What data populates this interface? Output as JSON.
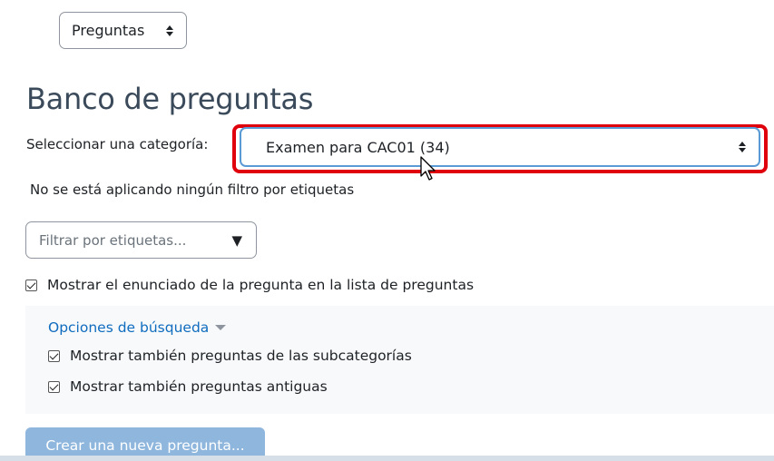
{
  "nav": {
    "select_value": "Preguntas"
  },
  "page": {
    "title": "Banco de preguntas"
  },
  "category": {
    "label": "Seleccionar una categoría:",
    "selected": "Examen para CAC01 (34)"
  },
  "filter": {
    "status": "No se está aplicando ningún filtro por etiquetas",
    "placeholder": "Filtrar por etiquetas..."
  },
  "show_question_text": {
    "label": "Mostrar el enunciado de la pregunta en la lista de preguntas",
    "checked": true
  },
  "search_options": {
    "title": "Opciones de búsqueda",
    "subcategories": {
      "label": "Mostrar también preguntas de las subcategorías",
      "checked": true
    },
    "old_questions": {
      "label": "Mostrar también preguntas antiguas",
      "checked": true
    }
  },
  "actions": {
    "create_label": "Crear una nueva pregunta..."
  },
  "colors": {
    "highlight": "#e0000d",
    "link": "#0f6cbf",
    "button": "#8fb6dd",
    "focus": "#5b9bd5"
  }
}
